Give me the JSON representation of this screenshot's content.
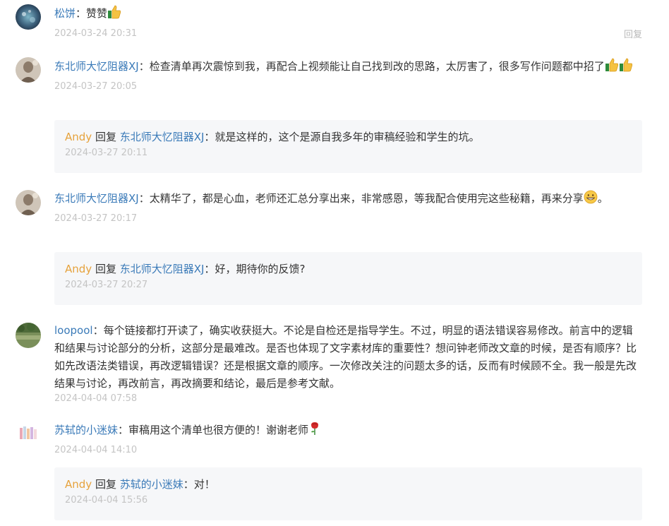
{
  "comments": [
    {
      "author": "松饼",
      "sep": "：",
      "text": "赞赞",
      "time": "2024-03-24 20:31",
      "reply_action": "回复"
    },
    {
      "author": "东北师大忆阻器XJ",
      "sep": "：",
      "text": "检查清单再次震惊到我，再配合上视频能让自己找到改的思路，太厉害了，很多写作问题都中招了",
      "time": "2024-03-27 20:05",
      "reply": {
        "author": "Andy",
        "verb": " 回复 ",
        "target": "东北师大忆阻器XJ",
        "sep": "：",
        "text": "就是这样的，这个是源自我多年的审稿经验和学生的坑。",
        "time": "2024-03-27 20:11"
      }
    },
    {
      "author": "东北师大忆阻器XJ",
      "sep": "：",
      "text": "太精华了，都是心血，老师还汇总分享出来，非常感恩，等我配合使用完这些秘籍，再来分享",
      "text_end": "。",
      "time": "2024-03-27 20:17",
      "reply": {
        "author": "Andy",
        "verb": " 回复 ",
        "target": "东北师大忆阻器XJ",
        "sep": "：",
        "text": "好，期待你的反馈?",
        "time": "2024-03-27 20:27"
      }
    },
    {
      "author": "loopool",
      "sep": "：",
      "text": "每个链接都打开读了，确实收获挺大。不论是自检还是指导学生。不过，明显的语法错误容易修改。前言中的逻辑和结果与讨论部分的分析，这部分是最难改。是否也体现了文字素材库的重要性？想问钟老师改文章的时候，是否有顺序？比如先改语法类错误，再改逻辑错误？还是根据文章的顺序。一次修改关注的问题太多的话，反而有时候顾不全。我一般是先改结果与讨论，再改前言，再改摘要和结论，最后是参考文献。",
      "time": "2024-04-04 07:58"
    },
    {
      "author": "苏轼的小迷妹",
      "sep": "：",
      "text": "审稿用这个清单也很方便的！谢谢老师",
      "time": "2024-04-04 14:10",
      "reply": {
        "author": "Andy",
        "verb": " 回复 ",
        "target": "苏轼的小迷妹",
        "sep": "：",
        "text": "对！",
        "time": "2024-04-04 15:56"
      }
    }
  ]
}
